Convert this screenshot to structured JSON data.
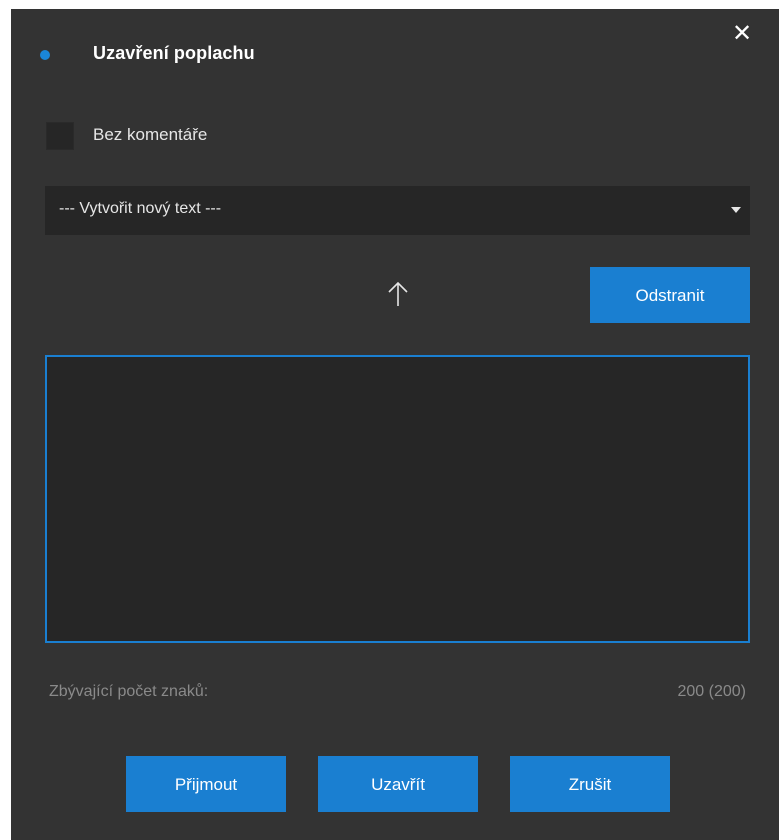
{
  "dialog": {
    "title": "Uzavření poplachu",
    "close_icon": "close-icon",
    "no_comment_label": "Bez komentáře",
    "no_comment_checked": false,
    "template_select_value": "--- Vytvořit nový text ---",
    "move_up_icon": "arrow-up-icon",
    "remove_label": "Odstranit",
    "comment_value": "",
    "remaining_label": "Zbývající počet znaků:",
    "remaining_value": "200 (200)",
    "accept_label": "Přijmout",
    "close_label": "Uzavřít",
    "cancel_label": "Zrušit"
  },
  "colors": {
    "background": "#333333",
    "field": "#262626",
    "accent": "#1a7fd1",
    "title_dot": "#1a86d9",
    "muted_text": "#8a8a8a"
  }
}
